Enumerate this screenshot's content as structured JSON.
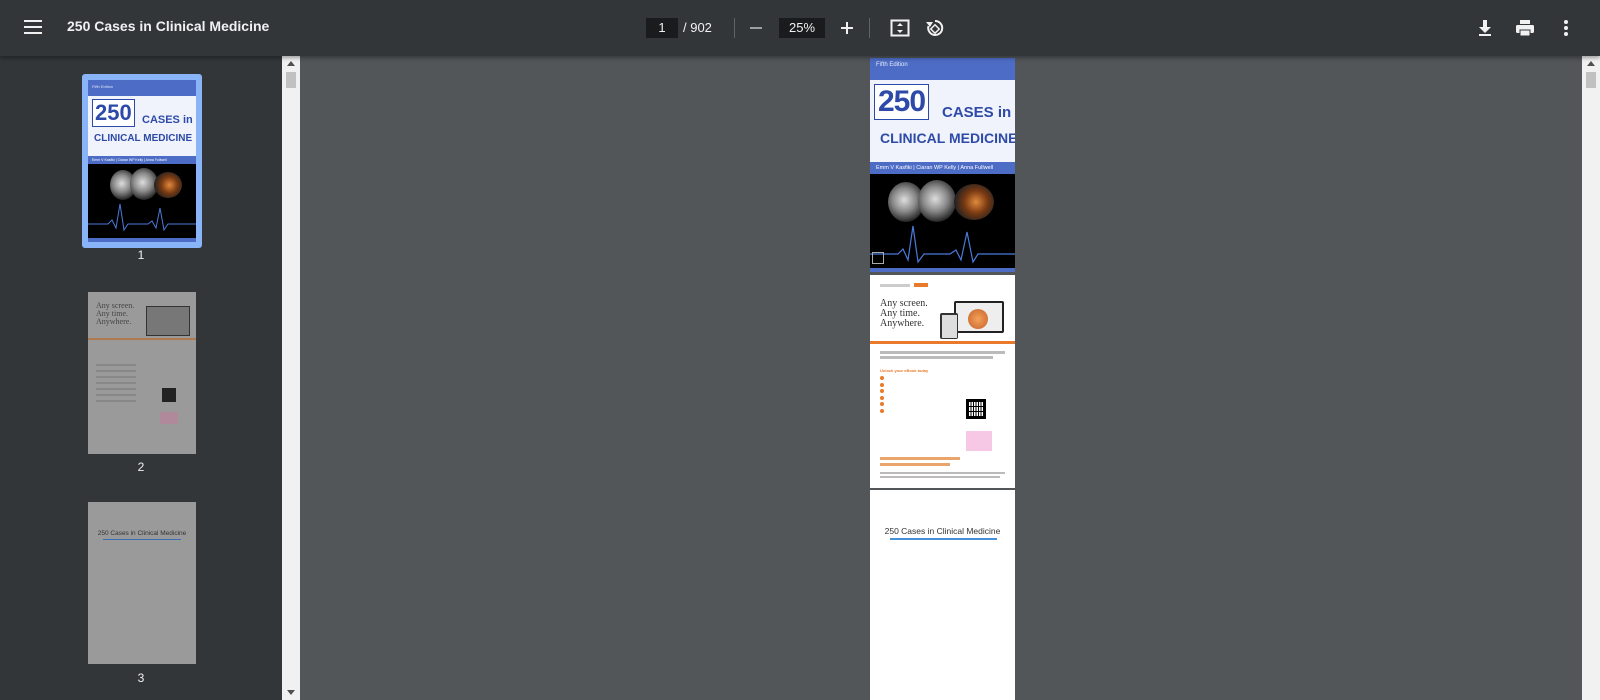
{
  "app": {
    "title": "250 Cases in Clinical Medicine"
  },
  "toolbar": {
    "current_page": "1",
    "total_pages": "/  902",
    "zoom": "25%"
  },
  "sidebar": {
    "thumbnails": [
      {
        "number": "1",
        "selected": true
      },
      {
        "number": "2",
        "selected": false
      },
      {
        "number": "3",
        "selected": false
      }
    ]
  },
  "document": {
    "cover": {
      "edition": "Fifth Edition",
      "number": "250",
      "cases": "CASES in",
      "subject": "CLINICAL MEDICINE",
      "authors": "Emm V Kasfiki  |  Ciaran WP Kelly  |  Anna Fullwell"
    },
    "ad_page": {
      "slogan": [
        "Any screen.",
        "Any time.",
        "Anywhere."
      ],
      "heading": "Unlock your eBook today"
    },
    "title_page": {
      "title": "250 Cases in Clinical Medicine"
    }
  },
  "colors": {
    "toolbar_bg": "#323639",
    "viewer_bg": "#525659",
    "selection": "#8ab4f8",
    "cover_blue": "#4d6cc6"
  }
}
